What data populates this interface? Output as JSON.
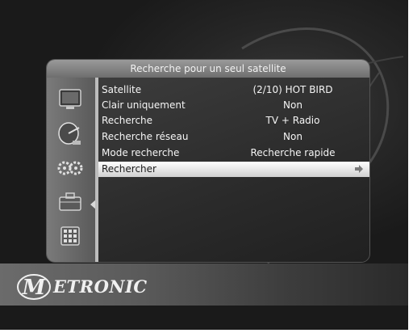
{
  "panel": {
    "title": "Recherche pour un seul satellite"
  },
  "menu": {
    "rows": [
      {
        "label": "Satellite",
        "value": "(2/10) HOT BIRD"
      },
      {
        "label": "Clair uniquement",
        "value": "Non"
      },
      {
        "label": "Recherche",
        "value": "TV + Radio"
      },
      {
        "label": "Recherche réseau",
        "value": "Non"
      },
      {
        "label": "Mode recherche",
        "value": "Recherche rapide"
      },
      {
        "label": "Rechercher",
        "value": ""
      }
    ],
    "selected_index": 5
  },
  "sidebar": {
    "icons": [
      "tv-icon",
      "satellite-dish-icon",
      "settings-gears-icon",
      "toolbox-icon",
      "grid-apps-icon"
    ],
    "active_index": 1
  },
  "brand": {
    "name": "ETRONIC",
    "logo_letter": "M"
  },
  "colors": {
    "highlight": "#e8e8e8",
    "title_bar": "#8a8a8a",
    "text": "#f5f5f5"
  }
}
